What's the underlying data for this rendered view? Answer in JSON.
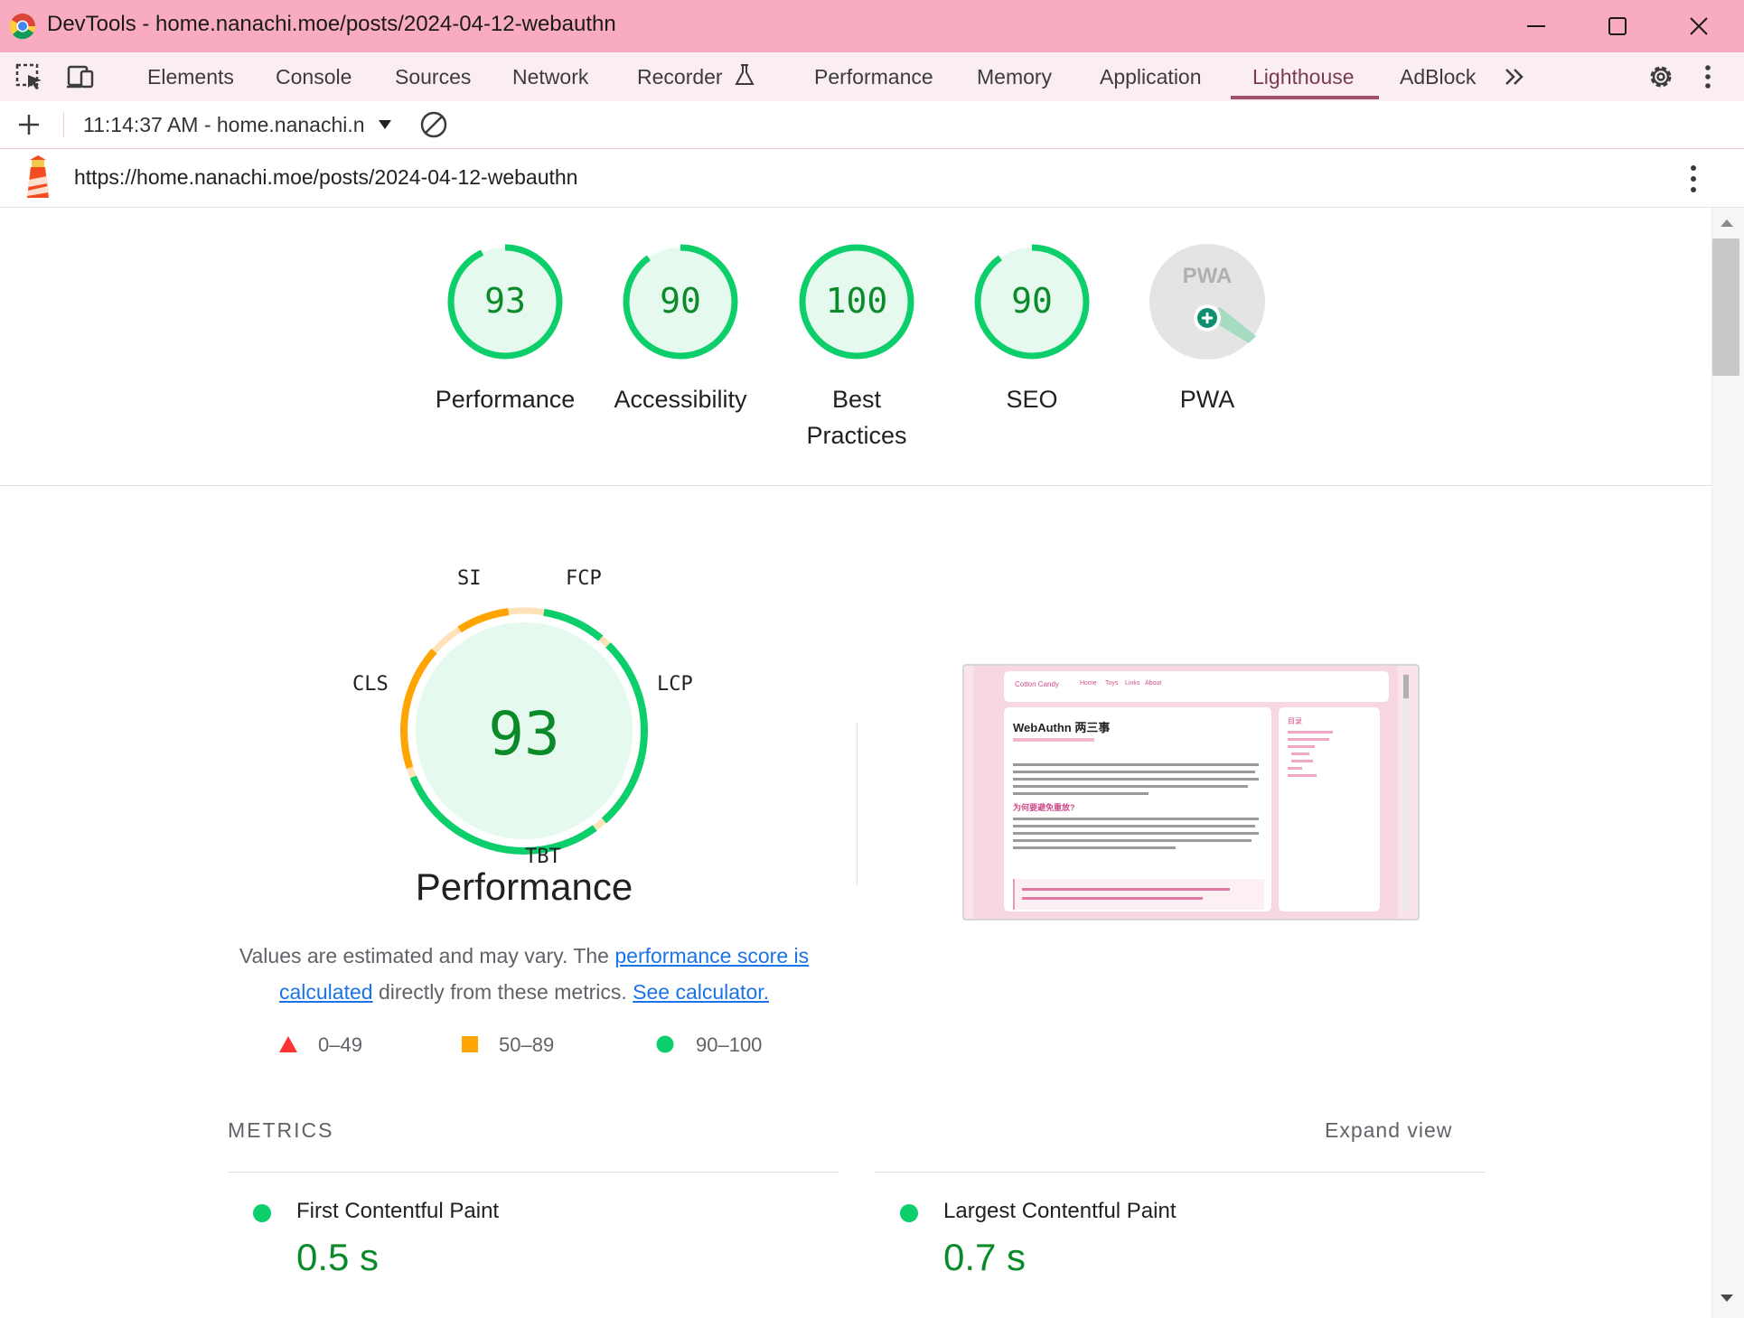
{
  "window": {
    "title": "DevTools - home.nanachi.moe/posts/2024-04-12-webauthn",
    "controls": [
      "minimize",
      "maximize",
      "close"
    ]
  },
  "tabs": [
    {
      "label": "Elements",
      "active": false
    },
    {
      "label": "Console",
      "active": false
    },
    {
      "label": "Sources",
      "active": false
    },
    {
      "label": "Network",
      "active": false
    },
    {
      "label": "Recorder",
      "active": false
    },
    {
      "label": "Performance",
      "active": false
    },
    {
      "label": "Memory",
      "active": false
    },
    {
      "label": "Application",
      "active": false
    },
    {
      "label": "Lighthouse",
      "active": true
    },
    {
      "label": "AdBlock",
      "active": false
    }
  ],
  "toolbar": {
    "report_selector": "11:14:37 AM - home.nanachi.n"
  },
  "report": {
    "url": "https://home.nanachi.moe/posts/2024-04-12-webauthn"
  },
  "categories": [
    {
      "label": "Performance",
      "score": "93"
    },
    {
      "label": "Accessibility",
      "score": "90"
    },
    {
      "label": "Best Practices",
      "score": "100"
    },
    {
      "label": "SEO",
      "score": "90"
    },
    {
      "label": "PWA",
      "score": "PWA"
    }
  ],
  "performance": {
    "score": "93",
    "title": "Performance",
    "metric_labels": {
      "si": "SI",
      "fcp": "FCP",
      "lcp": "LCP",
      "tbt": "TBT",
      "cls": "CLS"
    },
    "note_prefix": "Values are estimated and may vary. The ",
    "note_link1": "performance score is calculated",
    "note_mid": " directly from these metrics. ",
    "note_link2": "See calculator."
  },
  "legend": [
    {
      "range": "0–49",
      "shape": "triangle",
      "color": "#f33"
    },
    {
      "range": "50–89",
      "shape": "square",
      "color": "#ffa400"
    },
    {
      "range": "90–100",
      "shape": "circle",
      "color": "#0cce6b"
    }
  ],
  "metrics": {
    "heading": "METRICS",
    "expand_label": "Expand view",
    "items": [
      {
        "name": "First Contentful Paint",
        "value": "0.5 s"
      },
      {
        "name": "Largest Contentful Paint",
        "value": "0.7 s"
      }
    ]
  },
  "screenshot_preview": {
    "site_name": "Cotton Candy",
    "nav": [
      "Home",
      "Toys",
      "Links",
      "About"
    ],
    "post_title": "WebAuthn 两三事",
    "toc_heading": "目录",
    "section_heading": "为何要避免重放?"
  },
  "colors": {
    "titlebar": "#f9acbf",
    "tabbar": "#fbeef3",
    "pass": "#0cce6b",
    "average": "#ffa400",
    "fail": "#ff3333",
    "pass_text": "#0a8a28",
    "link": "#1a73e8"
  }
}
